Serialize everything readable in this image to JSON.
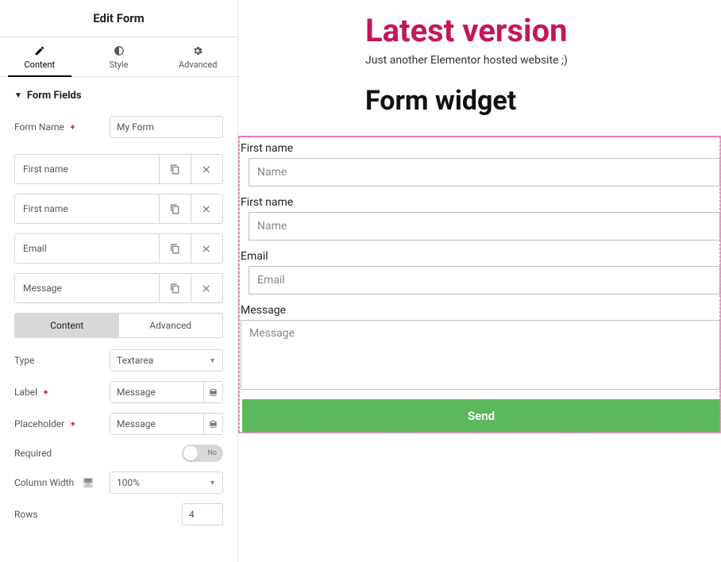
{
  "panel": {
    "title": "Edit Form",
    "tabs": {
      "content": "Content",
      "style": "Style",
      "advanced": "Advanced"
    },
    "section_form_fields": "Form Fields",
    "form_name_label": "Form Name",
    "form_name_value": "My Form",
    "fields": [
      {
        "label": "First name"
      },
      {
        "label": "First name"
      },
      {
        "label": "Email"
      },
      {
        "label": "Message"
      }
    ],
    "sub_tabs": {
      "content": "Content",
      "advanced": "Advanced"
    },
    "type_label": "Type",
    "type_value": "Textarea",
    "label_label": "Label",
    "label_value": "Message",
    "placeholder_label": "Placeholder",
    "placeholder_value": "Message",
    "required_label": "Required",
    "required_value": "No",
    "colwidth_label": "Column Width",
    "colwidth_value": "100%",
    "rows_label": "Rows",
    "rows_value": "4"
  },
  "preview": {
    "site_title": "Latest version",
    "tagline": "Just another Elementor hosted website ;)",
    "widget_title": "Form widget",
    "form_fields": [
      {
        "label": "First name",
        "placeholder": "Name",
        "indent": true
      },
      {
        "label": "First name",
        "placeholder": "Name",
        "indent": true
      },
      {
        "label": "Email",
        "placeholder": "Email",
        "indent": true
      }
    ],
    "message_label": "Message",
    "message_placeholder": "Message",
    "send": "Send"
  }
}
